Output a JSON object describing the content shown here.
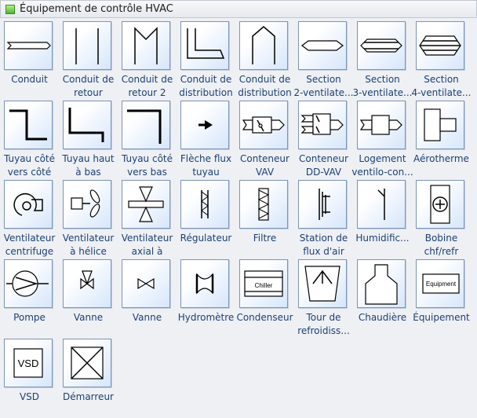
{
  "panel": {
    "title": "Équipement de contrôle HVAC",
    "icon": "stencil-icon"
  },
  "items": [
    {
      "l1": "Conduit",
      "l2": "",
      "icon": "duct"
    },
    {
      "l1": "Conduit de",
      "l2": "retour",
      "icon": "return-duct"
    },
    {
      "l1": "Conduit de",
      "l2": "retour 2",
      "icon": "return-duct-2"
    },
    {
      "l1": "Conduit de",
      "l2": "distribution",
      "icon": "supply-duct"
    },
    {
      "l1": "Conduit de",
      "l2": "distribution",
      "icon": "supply-duct-2"
    },
    {
      "l1": "Section",
      "l2": "2-ventilate...",
      "icon": "section-2"
    },
    {
      "l1": "Section",
      "l2": "3-ventilate...",
      "icon": "section-3"
    },
    {
      "l1": "Section",
      "l2": "4-ventilate...",
      "icon": "section-4"
    },
    {
      "l1": "Tuyau côté",
      "l2": "vers côté",
      "icon": "pipe-side"
    },
    {
      "l1": "Tuyau haut",
      "l2": "à bas",
      "icon": "pipe-up-down"
    },
    {
      "l1": "Tuyau côté",
      "l2": "vers bas",
      "icon": "pipe-side-down"
    },
    {
      "l1": "Flèche flux",
      "l2": "tuyau",
      "icon": "flow-arrow"
    },
    {
      "l1": "Conteneur",
      "l2": "VAV",
      "icon": "vav"
    },
    {
      "l1": "Conteneur",
      "l2": "DD-VAV",
      "icon": "dd-vav"
    },
    {
      "l1": "Logement",
      "l2": "ventilo-con...",
      "icon": "fan-coil"
    },
    {
      "l1": "Aérotherme",
      "l2": "",
      "icon": "unit-heater"
    },
    {
      "l1": "Ventilateur",
      "l2": "centrifuge",
      "icon": "centrifugal-fan"
    },
    {
      "l1": "Ventilateur",
      "l2": "à hélice",
      "icon": "propeller-fan"
    },
    {
      "l1": "Ventilateur",
      "l2": "axial à",
      "icon": "axial-fan"
    },
    {
      "l1": "Régulateur",
      "l2": "",
      "icon": "damper"
    },
    {
      "l1": "Filtre",
      "l2": "",
      "icon": "filter"
    },
    {
      "l1": "Station de",
      "l2": "flux d'air",
      "icon": "airflow-station"
    },
    {
      "l1": "Humidific...",
      "l2": "",
      "icon": "humidifier"
    },
    {
      "l1": "Bobine",
      "l2": "chf/refr",
      "icon": "coil"
    },
    {
      "l1": "Pompe",
      "l2": "",
      "icon": "pump"
    },
    {
      "l1": "Vanne",
      "l2": "",
      "icon": "valve-3way"
    },
    {
      "l1": "Vanne",
      "l2": "",
      "icon": "valve"
    },
    {
      "l1": "Hydromètre",
      "l2": "",
      "icon": "hydrometer"
    },
    {
      "l1": "Condenseur",
      "l2": "",
      "icon": "condenser",
      "text": "Chiller"
    },
    {
      "l1": "Tour de",
      "l2": "refroidiss...",
      "icon": "cooling-tower"
    },
    {
      "l1": "Chaudière",
      "l2": "",
      "icon": "boiler"
    },
    {
      "l1": "Équipement",
      "l2": "",
      "icon": "equipment",
      "text": "Equipment"
    },
    {
      "l1": "VSD",
      "l2": "",
      "icon": "vsd",
      "text": "VSD"
    },
    {
      "l1": "Démarreur",
      "l2": "",
      "icon": "starter"
    }
  ]
}
